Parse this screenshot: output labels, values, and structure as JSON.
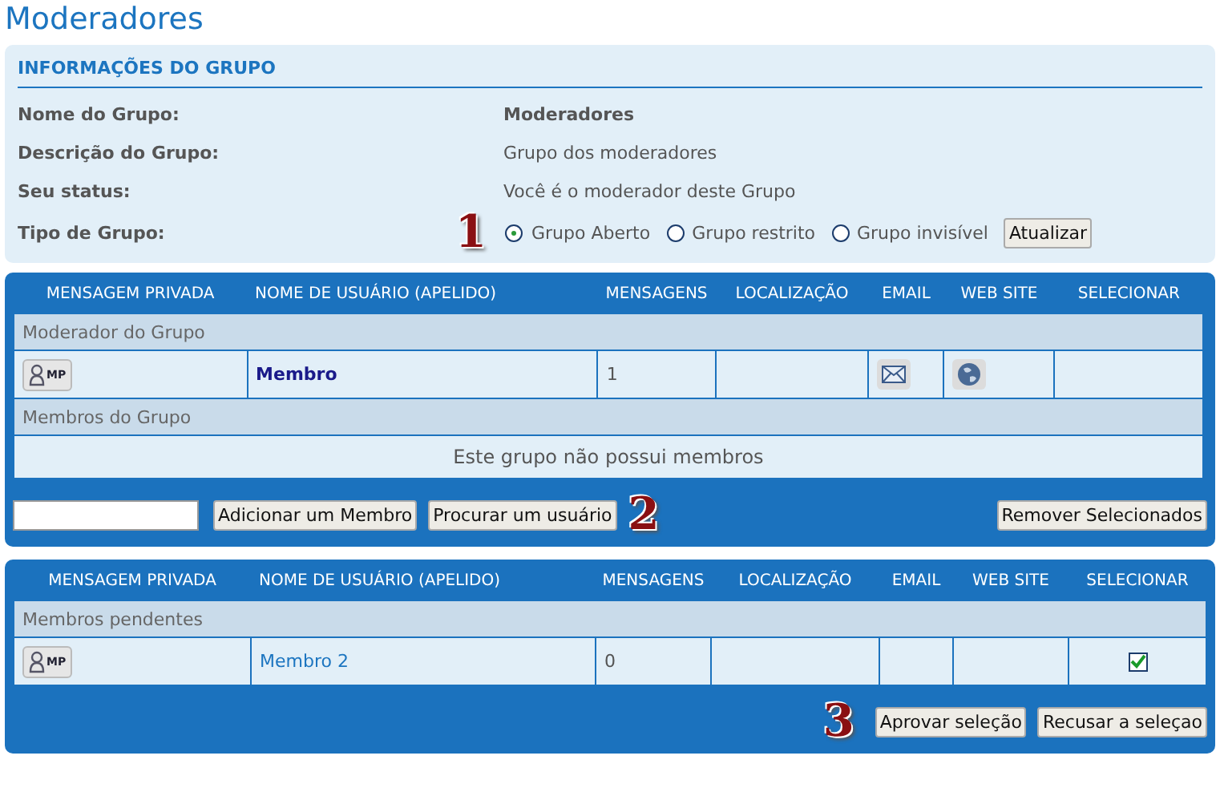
{
  "title": "Moderadores",
  "info": {
    "heading": "INFORMAÇÕES DO GRUPO",
    "rows": [
      {
        "label": "Nome do Grupo:",
        "value": "Moderadores",
        "bold": true
      },
      {
        "label": "Descrição do Grupo:",
        "value": "Grupo dos moderadores",
        "bold": false
      },
      {
        "label": "Seu status:",
        "value": "Você é o moderador deste Grupo",
        "bold": false
      }
    ],
    "type_row": {
      "label": "Tipo de Grupo:",
      "marker": "1",
      "options": [
        {
          "label": "Grupo Aberto",
          "selected": true
        },
        {
          "label": "Grupo restrito",
          "selected": false
        },
        {
          "label": "Grupo invisível",
          "selected": false
        }
      ],
      "button": "Atualizar"
    }
  },
  "tables": [
    {
      "columns": [
        "MENSAGEM PRIVADA",
        "NOME DE USUÁRIO (APELIDO)",
        "MENSAGENS",
        "LOCALIZAÇÃO",
        "EMAIL",
        "WEB SITE",
        "SELECIONAR"
      ],
      "groups": [
        {
          "heading": "Moderador do Grupo",
          "rows": [
            {
              "pm": "MP",
              "name": "Membro",
              "name_bold": true,
              "posts": "1",
              "email": true,
              "website": true
            }
          ]
        },
        {
          "heading": "Membros do Grupo",
          "empty": "Este grupo não possui membros"
        }
      ],
      "footer": {
        "left": [
          {
            "kind": "field"
          },
          {
            "kind": "button",
            "label": "Adicionar um Membro"
          },
          {
            "kind": "button",
            "label": "Procurar um usuário"
          },
          {
            "kind": "marker",
            "label": "2"
          }
        ],
        "right": [
          {
            "kind": "button",
            "label": "Remover Selecionados"
          }
        ]
      }
    },
    {
      "columns": [
        "MENSAGEM PRIVADA",
        "NOME DE USUÁRIO (APELIDO)",
        "MENSAGENS",
        "LOCALIZAÇÃO",
        "EMAIL",
        "WEB SITE",
        "SELECIONAR"
      ],
      "groups": [
        {
          "heading": "Membros pendentes",
          "rows": [
            {
              "pm": "MP",
              "name": "Membro 2",
              "name_bold": false,
              "posts": "0",
              "email": false,
              "website": false,
              "checked": true
            }
          ]
        }
      ],
      "footer": {
        "right": [
          {
            "kind": "marker",
            "label": "3"
          },
          {
            "kind": "button",
            "label": "Aprovar seleção"
          },
          {
            "kind": "button",
            "label": "Recusar a seleçao"
          }
        ]
      }
    }
  ]
}
